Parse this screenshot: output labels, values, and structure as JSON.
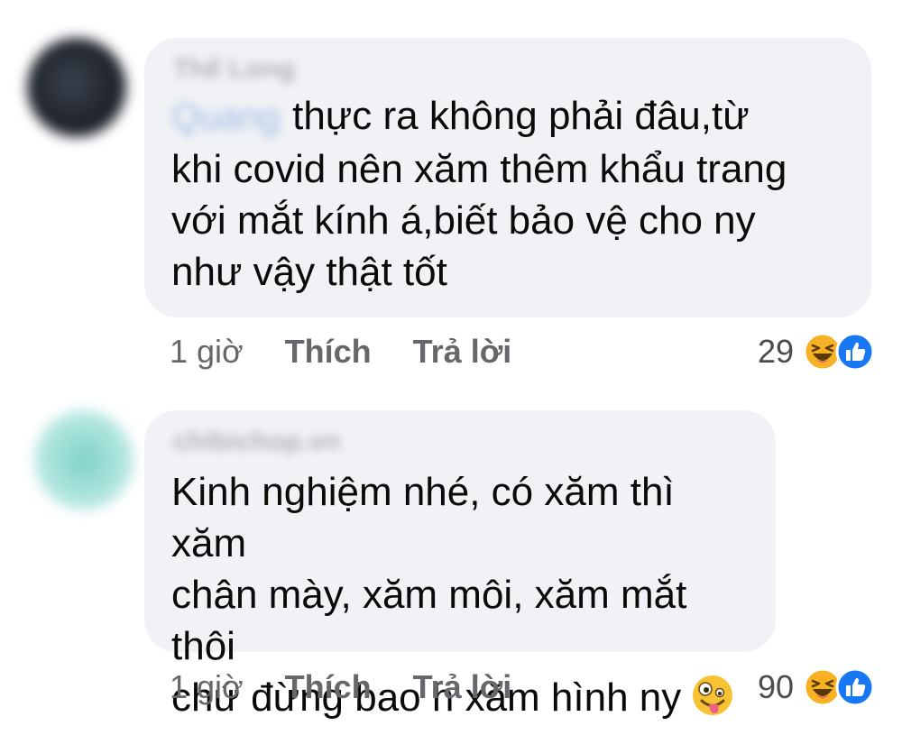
{
  "comments": [
    {
      "author": "Thế Long",
      "mention": "Quang",
      "text": "thực ra không phải đâu,từ\nkhi covid nên xăm thêm khẩu trang\nvới mắt kính á,biết bảo vệ cho ny\nnhư vậy thật tốt",
      "time": "1 giờ",
      "like_label": "Thích",
      "reply_label": "Trả lời",
      "reaction_count": "29",
      "reaction_icons": [
        "haha-icon",
        "like-icon"
      ]
    },
    {
      "author": "chibichop.vn",
      "text": "Kinh nghiệm nhé, có xăm thì xăm\nchân mày, xăm môi, xăm mắt thôi\nchứ đừng bao h xăm hình ny",
      "inline_emoji": "zany-face-icon",
      "time": "1 giờ",
      "like_label": "Thích",
      "reply_label": "Trả lời",
      "reaction_count": "90",
      "reaction_icons": [
        "haha-icon",
        "like-icon"
      ]
    }
  ],
  "colors": {
    "bubble": "#f0f2f5",
    "secondary_text": "#65676b",
    "like_blue": "#1877f2",
    "haha_yellow": "#f7b125"
  }
}
